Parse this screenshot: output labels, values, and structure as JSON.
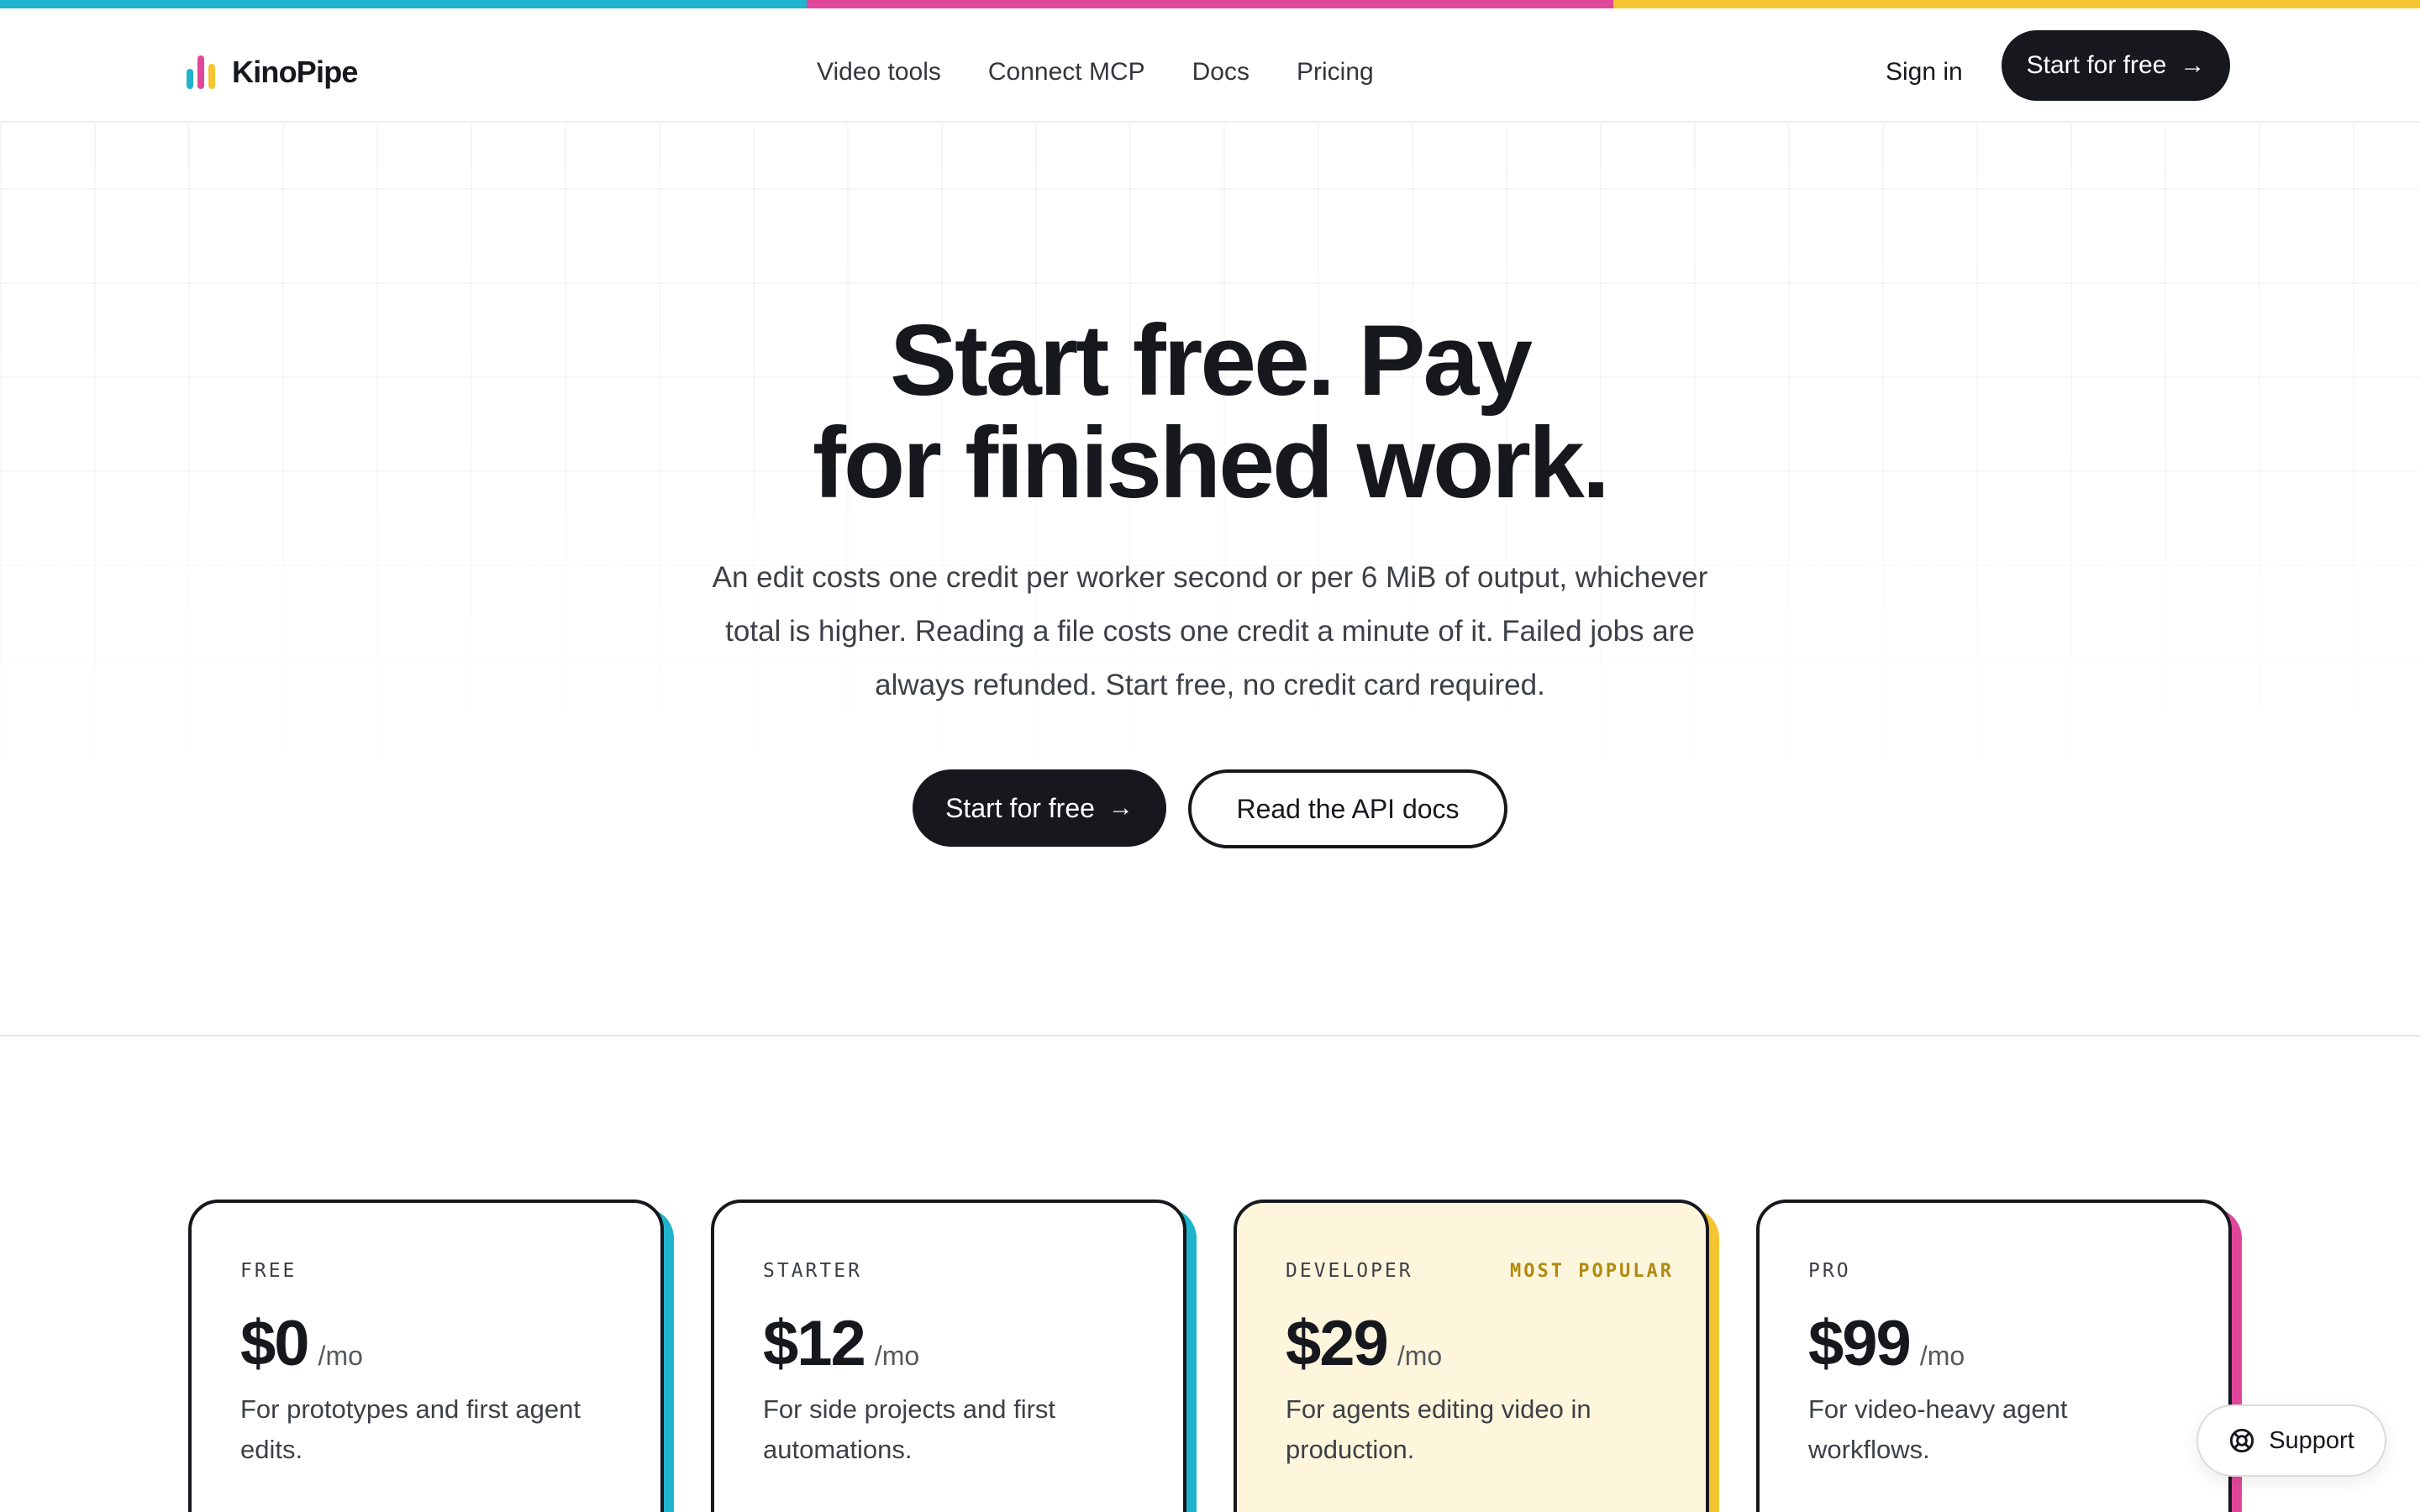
{
  "colors": {
    "accent_cyan": "#1fb3cc",
    "accent_pink": "#e0479b",
    "accent_yellow": "#f4c531",
    "ink": "#16181d",
    "highlight_card_bg": "#fef6dc"
  },
  "brand": {
    "name": "KinoPipe",
    "icon": "bars-logo-icon"
  },
  "nav": {
    "links": [
      "Video tools",
      "Connect MCP",
      "Docs",
      "Pricing"
    ],
    "sign_in": "Sign in",
    "cta_label": "Start for free",
    "cta_icon": "arrow-right-icon"
  },
  "hero": {
    "title_line1": "Start free. Pay",
    "title_line2": "for finished work.",
    "subtitle_line1": "An edit costs one credit per worker second or per 6 MiB of output, whichever",
    "subtitle_line2": "total is higher. Reading a file costs one credit a minute of it. Failed jobs are",
    "subtitle_line3": "always refunded. Start free, no credit card required.",
    "primary_label": "Start for free",
    "secondary_label": "Read the API docs"
  },
  "plans": [
    {
      "tier": "FREE",
      "price": "$0",
      "per": "/mo",
      "desc_line1": "For prototypes and first agent",
      "desc_line2": "edits.",
      "badge": "",
      "accent": "#1fb3cc"
    },
    {
      "tier": "STARTER",
      "price": "$12",
      "per": "/mo",
      "desc_line1": "For side projects and first",
      "desc_line2": "automations.",
      "badge": "",
      "accent": "#1fb3cc"
    },
    {
      "tier": "DEVELOPER",
      "price": "$29",
      "per": "/mo",
      "desc_line1": "For agents editing video in",
      "desc_line2": "production.",
      "badge": "MOST POPULAR",
      "accent": "#f4c531"
    },
    {
      "tier": "PRO",
      "price": "$99",
      "per": "/mo",
      "desc_line1": "For video-heavy agent",
      "desc_line2": "workflows.",
      "badge": "",
      "accent": "#e0479b"
    }
  ],
  "support": {
    "label": "Support",
    "icon": "lifebuoy-icon"
  }
}
